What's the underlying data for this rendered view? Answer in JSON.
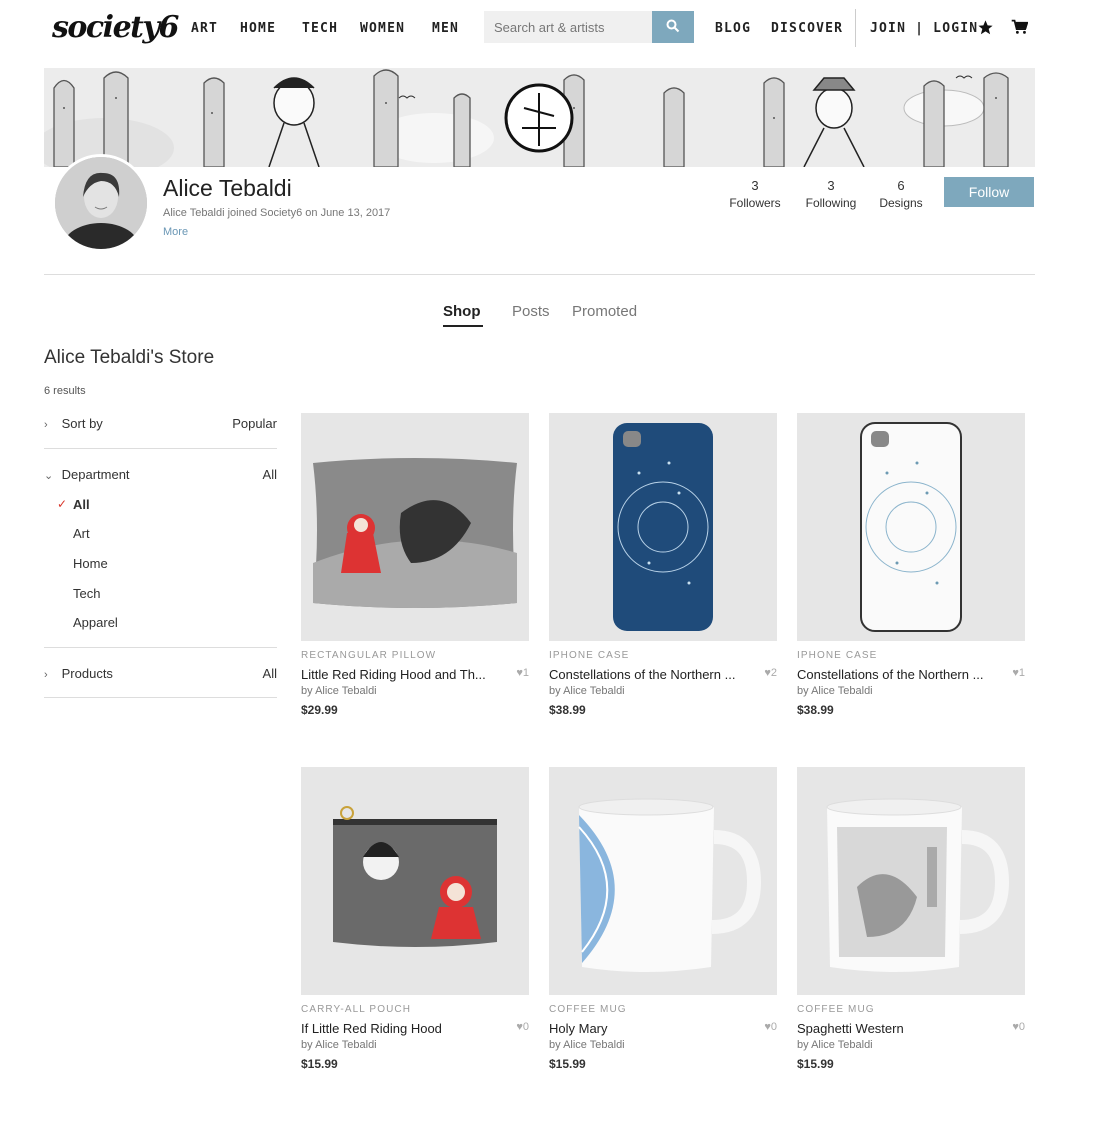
{
  "nav": {
    "logo": "society6",
    "links": [
      "ART",
      "HOME",
      "TECH",
      "WOMEN",
      "MEN"
    ],
    "search_placeholder": "Search art & artists",
    "right_links": [
      "BLOG",
      "DISCOVER"
    ],
    "auth": "JOIN | LOGIN"
  },
  "profile": {
    "name": "Alice Tebaldi",
    "joined": "Alice Tebaldi joined Society6 on June 13, 2017",
    "more": "More",
    "stats": [
      {
        "value": "3",
        "label": "Followers"
      },
      {
        "value": "3",
        "label": "Following"
      },
      {
        "value": "6",
        "label": "Designs"
      }
    ],
    "follow_label": "Follow"
  },
  "tabs": [
    "Shop",
    "Posts",
    "Promoted"
  ],
  "sidebar": {
    "store_title": "Alice Tebaldi's Store",
    "results": "6 results",
    "sort_label": "Sort by",
    "sort_value": "Popular",
    "department_label": "Department",
    "department_value": "All",
    "departments": [
      "All",
      "Art",
      "Home",
      "Tech",
      "Apparel"
    ],
    "products_label": "Products",
    "products_value": "All"
  },
  "products": [
    {
      "category": "RECTANGULAR PILLOW",
      "title": "Little Red Riding Hood and Th...",
      "likes": "1",
      "artist": "by Alice Tebaldi",
      "price": "$29.99"
    },
    {
      "category": "IPHONE CASE",
      "title": "Constellations of the Northern ...",
      "likes": "2",
      "artist": "by Alice Tebaldi",
      "price": "$38.99"
    },
    {
      "category": "IPHONE CASE",
      "title": "Constellations of the Northern ...",
      "likes": "1",
      "artist": "by Alice Tebaldi",
      "price": "$38.99"
    },
    {
      "category": "CARRY-ALL POUCH",
      "title": "If Little Red Riding Hood",
      "likes": "0",
      "artist": "by Alice Tebaldi",
      "price": "$15.99"
    },
    {
      "category": "COFFEE MUG",
      "title": "Holy Mary",
      "likes": "0",
      "artist": "by Alice Tebaldi",
      "price": "$15.99"
    },
    {
      "category": "COFFEE MUG",
      "title": "Spaghetti Western",
      "likes": "0",
      "artist": "by Alice Tebaldi",
      "price": "$15.99"
    }
  ],
  "colors": {
    "accent": "#7ea8bd",
    "check": "#d9362b",
    "link": "#6a97b5"
  },
  "icons": [
    "search-icon",
    "star-icon",
    "cart-icon",
    "heart-icon",
    "chevron-right-icon",
    "chevron-down-icon",
    "check-icon"
  ]
}
